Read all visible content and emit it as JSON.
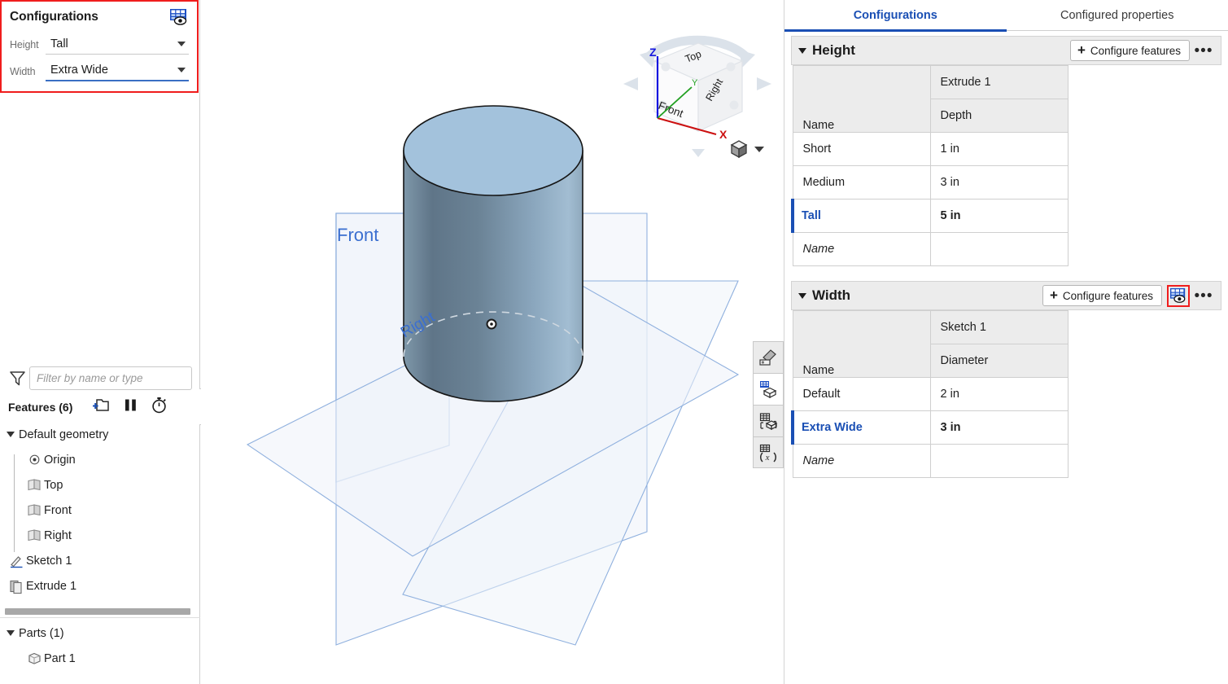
{
  "left_panel": {
    "config_box": {
      "title": "Configurations",
      "table_eye_icon": "configuration-table-eye-icon",
      "rows": [
        {
          "label": "Height",
          "value": "Tall",
          "focused": false
        },
        {
          "label": "Width",
          "value": "Extra Wide",
          "focused": true
        }
      ]
    },
    "filter": {
      "icon": "filter-funnel-icon",
      "placeholder": "Filter by name or type",
      "value": ""
    },
    "features": {
      "label": "Features (6)",
      "tools": [
        {
          "name": "add-folder-icon",
          "label": "New folder"
        },
        {
          "name": "rollback-pause-icon",
          "label": "Rollback"
        },
        {
          "name": "history-stopwatch-icon",
          "label": "History"
        }
      ],
      "tree_toggle_icon": "tree-list-toggle-icon"
    },
    "tree": [
      {
        "label": "Default geometry",
        "icon": "chevron-down-icon",
        "level": 0,
        "expandable": true
      },
      {
        "label": "Origin",
        "icon": "origin-point-icon",
        "level": 1
      },
      {
        "label": "Top",
        "icon": "plane-icon",
        "level": 1
      },
      {
        "label": "Front",
        "icon": "plane-icon",
        "level": 1
      },
      {
        "label": "Right",
        "icon": "plane-icon",
        "level": 1
      },
      {
        "label": "Sketch 1",
        "icon": "sketch-pencil-icon",
        "level": 0
      },
      {
        "label": "Extrude 1",
        "icon": "extrude-icon",
        "level": 0
      }
    ],
    "parts": {
      "header": "Parts (1)",
      "items": [
        {
          "label": "Part 1",
          "icon": "part-solid-icon"
        }
      ]
    }
  },
  "viewport": {
    "view_cube": {
      "faces": [
        "Top",
        "Front",
        "Right"
      ],
      "axes": [
        {
          "label": "Z",
          "color": "#1515e0"
        },
        {
          "label": "Y",
          "color": "#22a022"
        },
        {
          "label": "X",
          "color": "#cc1111"
        }
      ]
    },
    "display_mode": {
      "icon": "shaded-cube-icon",
      "caret": "chevron-down-icon"
    },
    "planes": [
      {
        "label": "Front",
        "color": "#3b6fd0"
      },
      {
        "label": "Right",
        "color": "#3b6fd0"
      }
    ],
    "model": {
      "name": "cylinder-part",
      "top_color": "#a3c2dc",
      "side_dark": "#5d7486",
      "side_light": "#9cb8cf",
      "edge_color": "#1b1b1b"
    },
    "toolbar": [
      {
        "name": "appearance-tool-icon",
        "active": true
      },
      {
        "name": "configuration-cube-icon",
        "active": false
      },
      {
        "name": "configure-part-icon",
        "active": true
      },
      {
        "name": "variable-function-icon",
        "active": true
      }
    ]
  },
  "right_panel": {
    "tabs": [
      {
        "label": "Configurations",
        "active": true
      },
      {
        "label": "Configured properties",
        "active": false
      }
    ],
    "sections": [
      {
        "title": "Height",
        "collapse_icon": "chevron-down-icon",
        "configure_label": "Configure features",
        "plus_icon": "plus-icon",
        "more_icon": "more-options-icon",
        "table_eye_icon": "configuration-table-eye-icon",
        "table_eye_visible": false,
        "table_eye_highlighted": false,
        "feature_header": "Extrude 1",
        "columns": [
          "Name",
          "Depth"
        ],
        "rows": [
          {
            "name": "Short",
            "value": "1 in",
            "active": false
          },
          {
            "name": "Medium",
            "value": "3 in",
            "active": false
          },
          {
            "name": "Tall",
            "value": "5 in",
            "active": true
          }
        ],
        "new_row_placeholder": "Name"
      },
      {
        "title": "Width",
        "collapse_icon": "chevron-down-icon",
        "configure_label": "Configure features",
        "plus_icon": "plus-icon",
        "more_icon": "more-options-icon",
        "table_eye_icon": "configuration-table-eye-icon",
        "table_eye_visible": true,
        "table_eye_highlighted": true,
        "feature_header": "Sketch 1",
        "columns": [
          "Name",
          "Diameter"
        ],
        "rows": [
          {
            "name": "Default",
            "value": "2 in",
            "active": false
          },
          {
            "name": "Extra Wide",
            "value": "3 in",
            "active": true
          }
        ],
        "new_row_placeholder": "Name"
      }
    ]
  },
  "colors": {
    "accent_blue": "#1a4fb4",
    "highlight_red": "#f01d1d",
    "header_gray": "#ececec",
    "border_gray": "#cfcfcf"
  }
}
